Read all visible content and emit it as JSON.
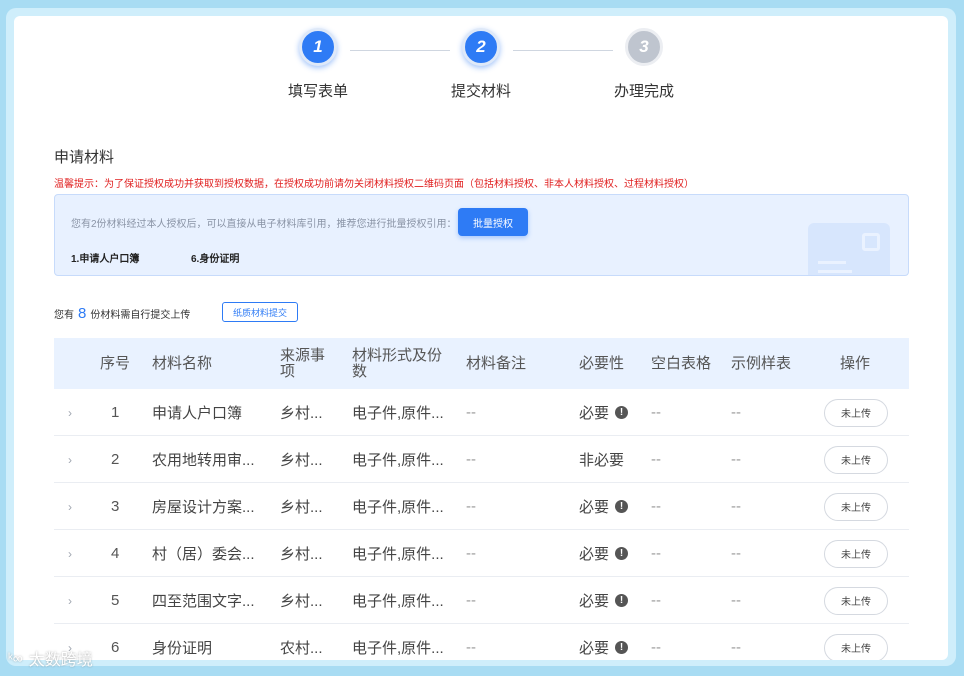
{
  "steps": [
    {
      "num": "1",
      "label": "填写表单",
      "state": "active"
    },
    {
      "num": "2",
      "label": "提交材料",
      "state": "active"
    },
    {
      "num": "3",
      "label": "办理完成",
      "state": "inactive"
    }
  ],
  "section_title": "申请材料",
  "warning": "温馨提示：为了保证授权成功并获取到授权数据，在授权成功前请勿关闭材料授权二维码页面（包括材料授权、非本人材料授权、过程材料授权）",
  "info": {
    "tip": "您有2份材料经过本人授权后，可以直接从电子材料库引用，推荐您进行批量授权引用：",
    "batch_button": "批量授权",
    "items": [
      "1.申请人户口簿",
      "6.身份证明"
    ]
  },
  "count": {
    "prefix": "您有",
    "number": "8",
    "suffix": "份材料需自行提交上传",
    "paper_button": "纸质材料提交"
  },
  "table": {
    "headers": [
      "序号",
      "材料名称",
      "来源事项",
      "材料形式及份数",
      "材料备注",
      "必要性",
      "空白表格",
      "示例样表",
      "操作"
    ],
    "rows": [
      {
        "seq": "1",
        "name": "申请人户口簿",
        "source": "乡村...",
        "form": "电子件,原件...",
        "note": "--",
        "required": "必要",
        "blank": "--",
        "sample": "--",
        "action": "未上传"
      },
      {
        "seq": "2",
        "name": "农用地转用审...",
        "source": "乡村...",
        "form": "电子件,原件...",
        "note": "--",
        "required": "非必要",
        "blank": "--",
        "sample": "--",
        "action": "未上传"
      },
      {
        "seq": "3",
        "name": "房屋设计方案...",
        "source": "乡村...",
        "form": "电子件,原件...",
        "note": "--",
        "required": "必要",
        "blank": "--",
        "sample": "--",
        "action": "未上传"
      },
      {
        "seq": "4",
        "name": "村（居）委会...",
        "source": "乡村...",
        "form": "电子件,原件...",
        "note": "--",
        "required": "必要",
        "blank": "--",
        "sample": "--",
        "action": "未上传"
      },
      {
        "seq": "5",
        "name": "四至范围文字...",
        "source": "乡村...",
        "form": "电子件,原件...",
        "note": "--",
        "required": "必要",
        "blank": "--",
        "sample": "--",
        "action": "未上传"
      },
      {
        "seq": "6",
        "name": "身份证明",
        "source": "农村...",
        "form": "电子件,原件...",
        "note": "--",
        "required": "必要",
        "blank": "--",
        "sample": "--",
        "action": "未上传"
      }
    ]
  },
  "watermark": "太数跨境",
  "colors": {
    "accent": "#2e7bf5",
    "warning": "#e02020",
    "header_bg": "#e9f2ff"
  }
}
